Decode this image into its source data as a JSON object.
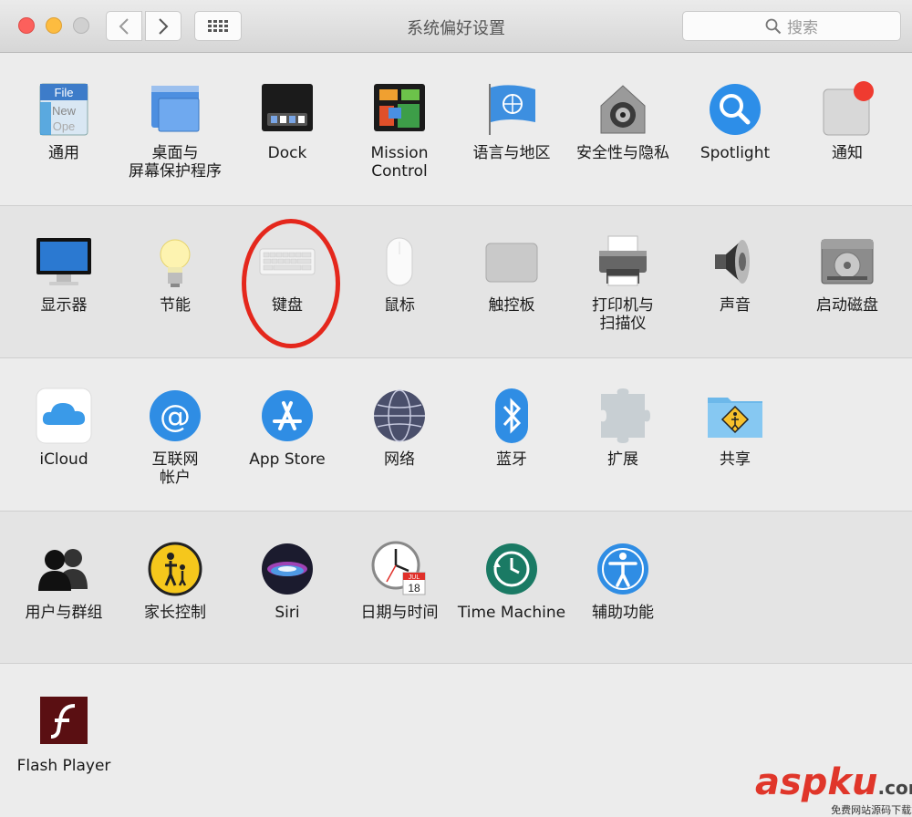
{
  "window": {
    "title": "系统偏好设置"
  },
  "toolbar": {
    "search_placeholder": "搜索"
  },
  "rows": [
    [
      {
        "label": "通用",
        "icon": "general-icon"
      },
      {
        "label": "桌面与\n屏幕保护程序",
        "icon": "desktop-screensaver-icon"
      },
      {
        "label": "Dock",
        "icon": "dock-icon"
      },
      {
        "label": "Mission\nControl",
        "icon": "mission-control-icon"
      },
      {
        "label": "语言与地区",
        "icon": "language-region-icon"
      },
      {
        "label": "安全性与隐私",
        "icon": "security-privacy-icon"
      },
      {
        "label": "Spotlight",
        "icon": "spotlight-icon"
      },
      {
        "label": "通知",
        "icon": "notifications-icon"
      }
    ],
    [
      {
        "label": "显示器",
        "icon": "displays-icon"
      },
      {
        "label": "节能",
        "icon": "energy-saver-icon"
      },
      {
        "label": "键盘",
        "icon": "keyboard-icon"
      },
      {
        "label": "鼠标",
        "icon": "mouse-icon"
      },
      {
        "label": "触控板",
        "icon": "trackpad-icon"
      },
      {
        "label": "打印机与\n扫描仪",
        "icon": "printer-scanner-icon"
      },
      {
        "label": "声音",
        "icon": "sound-icon"
      },
      {
        "label": "启动磁盘",
        "icon": "startup-disk-icon"
      }
    ],
    [
      {
        "label": "iCloud",
        "icon": "icloud-icon"
      },
      {
        "label": "互联网\n帐户",
        "icon": "internet-accounts-icon"
      },
      {
        "label": "App Store",
        "icon": "app-store-icon"
      },
      {
        "label": "网络",
        "icon": "network-icon"
      },
      {
        "label": "蓝牙",
        "icon": "bluetooth-icon"
      },
      {
        "label": "扩展",
        "icon": "extensions-icon"
      },
      {
        "label": "共享",
        "icon": "sharing-icon"
      }
    ],
    [
      {
        "label": "用户与群组",
        "icon": "users-groups-icon"
      },
      {
        "label": "家长控制",
        "icon": "parental-controls-icon"
      },
      {
        "label": "Siri",
        "icon": "siri-icon"
      },
      {
        "label": "日期与时间",
        "icon": "date-time-icon"
      },
      {
        "label": "Time Machine",
        "icon": "time-machine-icon"
      },
      {
        "label": "辅助功能",
        "icon": "accessibility-icon"
      }
    ],
    [
      {
        "label": "Flash Player",
        "icon": "flash-player-icon"
      }
    ]
  ],
  "icon_text": {
    "general_file": "File",
    "general_new": "New",
    "general_open": "Ope",
    "calendar_month": "JUL",
    "calendar_day": "18"
  },
  "watermark": {
    "brand": "aspku",
    "suffix": ".com",
    "tagline": "免费网站源码下载站!"
  },
  "colors": {
    "highlight": "#e4271c",
    "close": "#fc605c",
    "minimize": "#fdbc40"
  }
}
